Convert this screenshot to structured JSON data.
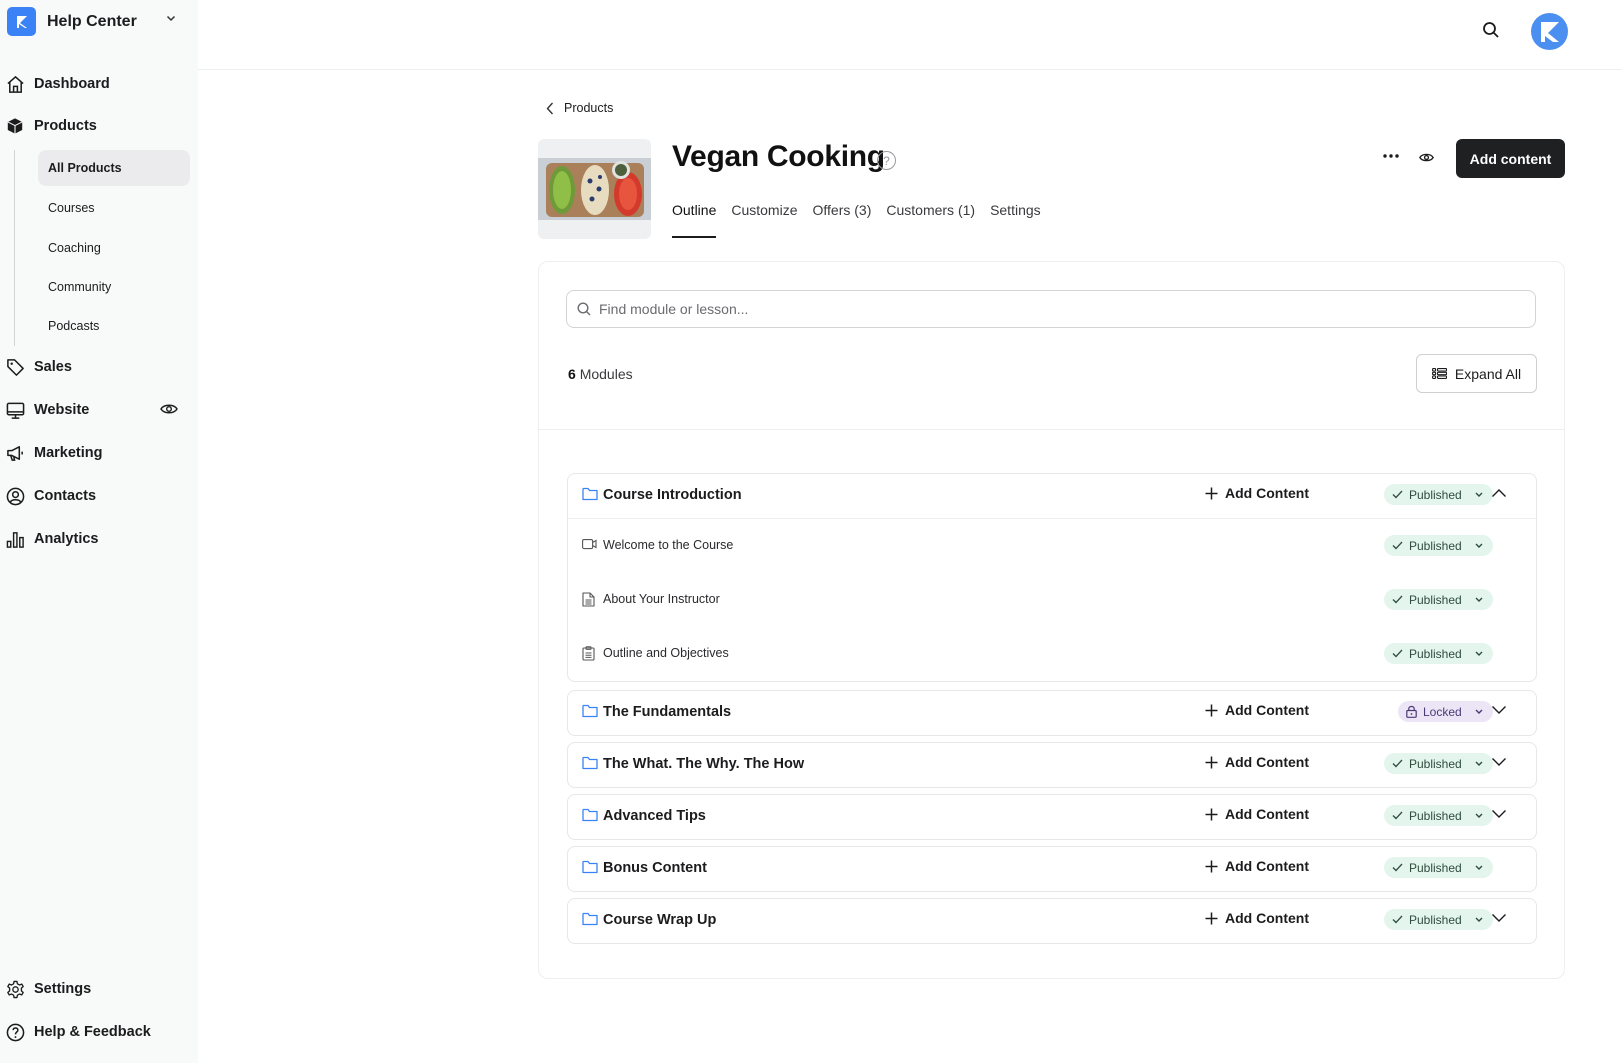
{
  "app": {
    "workspace_name": "Help Center",
    "brand_color": "#3b82f6"
  },
  "sidebar": {
    "items": [
      {
        "label": "Dashboard",
        "icon": "home-icon"
      },
      {
        "label": "Products",
        "icon": "box-icon"
      },
      {
        "label": "Sales",
        "icon": "tag-icon"
      },
      {
        "label": "Website",
        "icon": "monitor-icon"
      },
      {
        "label": "Marketing",
        "icon": "megaphone-icon"
      },
      {
        "label": "Contacts",
        "icon": "user-circle-icon"
      },
      {
        "label": "Analytics",
        "icon": "bar-chart-icon"
      }
    ],
    "sub_items": [
      {
        "label": "All Products",
        "active": true
      },
      {
        "label": "Courses"
      },
      {
        "label": "Coaching"
      },
      {
        "label": "Community"
      },
      {
        "label": "Podcasts"
      }
    ],
    "footer": [
      {
        "label": "Settings",
        "icon": "gear-icon"
      },
      {
        "label": "Help & Feedback",
        "icon": "question-circle-icon"
      }
    ]
  },
  "header": {
    "back_label": "Products",
    "title": "Vegan Cooking",
    "add_content_label": "Add content",
    "tabs": [
      {
        "label": "Outline",
        "active": true
      },
      {
        "label": "Customize"
      },
      {
        "label": "Offers (3)"
      },
      {
        "label": "Customers (1)"
      },
      {
        "label": "Settings"
      }
    ]
  },
  "outline": {
    "search_placeholder": "Find module or lesson...",
    "search_value": "",
    "modules_count": "6",
    "modules_label": "Modules",
    "expand_all_label": "Expand All",
    "add_content_label": "Add Content",
    "status_colors": {
      "published_bg": "#e3f5ed",
      "locked_bg": "#ece5f5"
    },
    "modules": [
      {
        "title": "Course Introduction",
        "status": "Published",
        "expanded": true,
        "lessons": [
          {
            "title": "Welcome to the Course",
            "type": "video",
            "status": "Published"
          },
          {
            "title": "About Your Instructor",
            "type": "text",
            "status": "Published"
          },
          {
            "title": "Outline and Objectives",
            "type": "quiz",
            "status": "Published"
          }
        ]
      },
      {
        "title": "The Fundamentals",
        "status": "Locked",
        "expanded": false
      },
      {
        "title": "The What. The Why. The How",
        "status": "Published",
        "expanded": false
      },
      {
        "title": "Advanced Tips",
        "status": "Published",
        "expanded": false
      },
      {
        "title": "Bonus Content",
        "status": "Published",
        "expanded": false,
        "no_toggle": true
      },
      {
        "title": "Course Wrap Up",
        "status": "Published",
        "expanded": false
      }
    ]
  }
}
